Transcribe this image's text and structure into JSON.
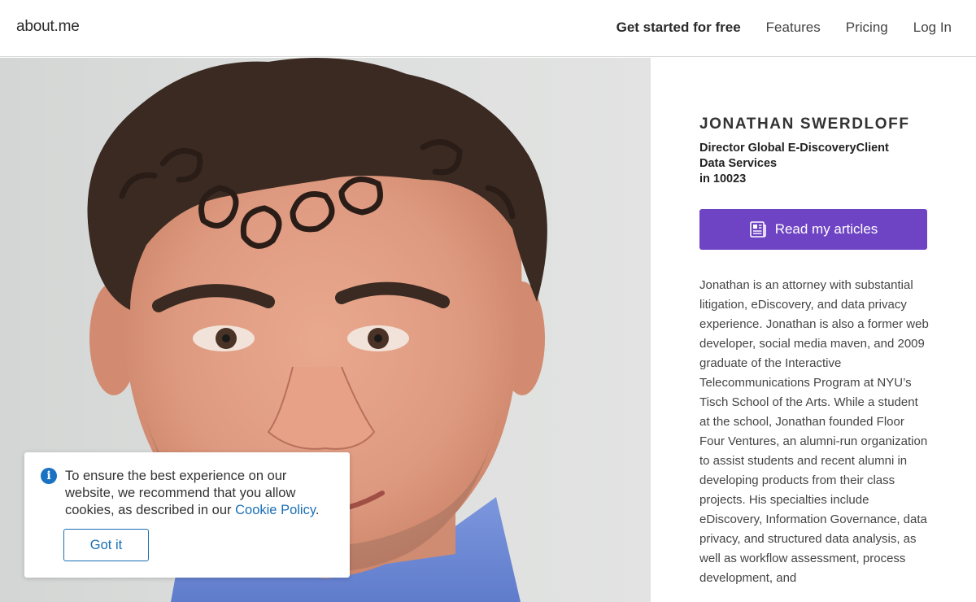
{
  "header": {
    "logo": "about.me",
    "nav": {
      "get_started": "Get started for free",
      "features": "Features",
      "pricing": "Pricing",
      "login": "Log In"
    }
  },
  "profile": {
    "name": "JONATHAN SWERDLOFF",
    "headline_line1": "Director Global E-DiscoveryClient",
    "headline_line2": "Data Services",
    "headline_line3": "in 10023",
    "articles_button": "Read my articles",
    "articles_icon": "newspaper-icon",
    "bio": "Jonathan is an attorney with substantial litigation, eDiscovery, and data privacy experience. Jonathan is also a former web developer, social media maven, and 2009 graduate of the Interactive Telecommunications Program at NYU’s Tisch School of the Arts. While a student at the school, Jonathan founded Floor Four Ventures, an alumni-run organization to assist students and recent alumni in developing products from their class projects. His specialties include eDiscovery, Information Governance, data privacy, and structured data analysis, as well as workflow assessment, process development, and"
  },
  "cookie_banner": {
    "icon": "info-icon",
    "message": "To ensure the best experience on our website, we recommend that you allow cookies, as described in our ",
    "link_text": "Cookie Policy",
    "message_end": ".",
    "button": "Got it"
  },
  "colors": {
    "accent": "#6e43c4",
    "link": "#1a6fb5"
  }
}
